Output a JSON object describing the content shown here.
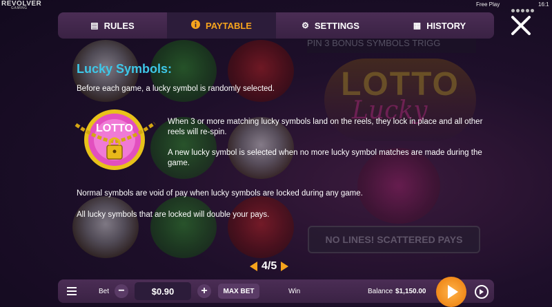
{
  "brand": {
    "name": "REVOLVER",
    "sub": "GAMING"
  },
  "status": {
    "mode": "Free Play",
    "time": "16:1"
  },
  "background": {
    "bonus_text": "PIN      3 BONUS SYMBOLS TRIGG",
    "logo_text": "LOTTO",
    "logo_script": "Lucky",
    "nolines_text": "NO LINES! SCATTERED PAYS"
  },
  "tabs": [
    {
      "label": "RULES",
      "icon": "document-icon",
      "active": false
    },
    {
      "label": "PAYTABLE",
      "icon": "info-icon",
      "active": true
    },
    {
      "label": "SETTINGS",
      "icon": "gear-icon",
      "active": false
    },
    {
      "label": "HISTORY",
      "icon": "calendar-icon",
      "active": false
    }
  ],
  "content": {
    "heading": "Lucky Symbols:",
    "intro": "Before each game, a lucky symbol is randomly selected.",
    "para1": "When 3 or more matching lucky symbols land on the reels, they lock in place and all other reels will re-spin.",
    "para2": "A new lucky symbol is selected when no more lucky symbol matches are made during the game.",
    "para3": "Normal symbols are void of pay when lucky symbols are locked during any game.",
    "para4": "All lucky symbols that are locked will double your pays.",
    "icon_text": "LOTTO"
  },
  "pager": {
    "current": "4/5"
  },
  "bottom": {
    "bet_label": "Bet",
    "bet_value": "$0.90",
    "minus": "−",
    "plus": "+",
    "max_bet": "MAX BET",
    "win_label": "Win",
    "balance_label": "Balance",
    "balance_value": "$1,150.00"
  },
  "colors": {
    "accent": "#f7a41d",
    "heading": "#3ec7e8",
    "bar": "#3a2244"
  }
}
